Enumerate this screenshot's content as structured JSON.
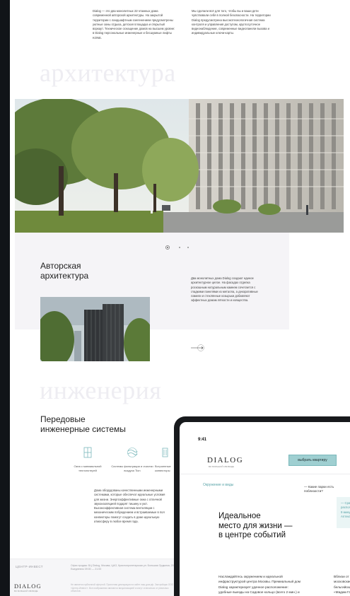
{
  "intro": {
    "col1": "Dialog — это два монолитных 22-этажных дома современной авторской архитектуры. На закрытой территории с ландшафтным озеленением предусмотрены уютные зоны отдыха, детская площадка и открытый воркаут. Техническое оснащение домов на высшем уровне: в Dialog персональные инженерные и бесшумные лифты KONE.",
    "col2": "Мы сделали всё для того, чтобы вы и ваши дети чувствовали себя в полной безопасности. На территории Dialog предусмотрена высокотехнологичная система контроля и управления доступом, круглосуточное видеонаблюдение, современные видеопанели вызова и индивидуальные ключи-карты."
  },
  "sections": {
    "architecture_word": "архитектура",
    "engineering_word": "инженерия"
  },
  "architecture": {
    "heading_line1": "Авторская",
    "heading_line2": "архитектура",
    "description": "Два монолитных дома Dialog создают единое архитектурное целое. На фасадах отделка роскошным натуральным камнем сочетается с гладкими панелями из металла, а декоративные ламели и стеклянные козырьки добавляют эффектных домам лёгкости и изящества."
  },
  "engineering": {
    "heading_line1": "Передовые",
    "heading_line2": "инженерные системы",
    "features": [
      {
        "label": "Окна с минимальной теплопотерей",
        "icon": "window-icon"
      },
      {
        "label": "Системы фильтрации и очистки воздуха Tion",
        "icon": "air-icon"
      },
      {
        "label": "Встроенные конвекторы",
        "icon": "convector-icon"
      }
    ],
    "description": "Дома оборудованы качественными инженерными системами, которые обеспечат идеальные условия для жизни. Энергоэффективные окна с отличной звукоизоляцией подарят тишину и уют. Высокоэффективная система вентиляции с механическим побуждением и встраиваемые в пол конвекторы помогут создать в доме идеальную атмосферу в любое время года."
  },
  "footer": {
    "developer": "ЦЕНТР-ИНВЕСТ",
    "office": "Офис продаж: БЦ Dialog, Москва, ЦАО, Краснопролетарская ул. Большая Ордынка, 20. Ежедневно 09:00 — 21:00",
    "logo": "DIALOG",
    "logo_sub": "ВО БОЛЬШОЙ СВОБОДЕ",
    "legal": "Не является публичной офертой. Проектная декларация на сайте наш.дом.рф. Застройщик ООО «Центр-Инвест». Все изображения являются визуализацией и могут отличаться от реальных объектов."
  },
  "tablet": {
    "time": "9:41",
    "logo": "DIALOG",
    "logo_sub": "ВО БОЛЬШОЙ СВОБОДЕ",
    "cta": "выбрать квартиру",
    "breadcrumb": "Окружение и виды",
    "question": "— Какие парки есть поблизости?",
    "answer": "— Сразу за... расположен... а в 9 минуто... Аптекарск...",
    "heading_line1": "Идеальное",
    "heading_line2": "место для жизни —",
    "heading_line3": "в центре событий",
    "body": "Наслаждайтесь окружением и идеальной инфраструктурой центра Москвы. Премиальный дом Dialog характеризует удачное расположение: удобные выезды на Садовое кольцо (всего 2 мин.) и Проспект Мира (3 мин.),",
    "body2": "Вблизи от дома московские рес... бельгийский La... «Мадам Галифе... заведений Срет... практически вс... гранатый Алекс..."
  },
  "colors": {
    "accent": "#9fcfd1",
    "teal": "#7ab8bb",
    "ghost": "#eeedf2"
  }
}
